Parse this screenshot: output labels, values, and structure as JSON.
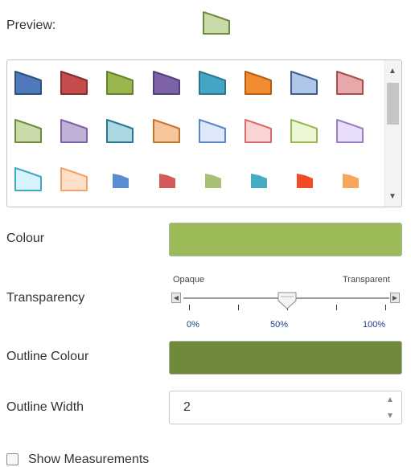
{
  "preview": {
    "label": "Preview:",
    "fill": "#cadbaa",
    "stroke": "#6f8a3a"
  },
  "gallery": {
    "symbols": [
      {
        "style": "outline",
        "fill": "#4f79b9",
        "stroke": "#2d4f80"
      },
      {
        "style": "outline",
        "fill": "#c44c4c",
        "stroke": "#8a2a2a"
      },
      {
        "style": "outline",
        "fill": "#98b84f",
        "stroke": "#65802f"
      },
      {
        "style": "outline",
        "fill": "#7e62a8",
        "stroke": "#54407a"
      },
      {
        "style": "outline",
        "fill": "#43a7c4",
        "stroke": "#2b7590"
      },
      {
        "style": "outline",
        "fill": "#f28a2f",
        "stroke": "#b55e12"
      },
      {
        "style": "outline",
        "fill": "#aec7e8",
        "stroke": "#3d5d8f"
      },
      {
        "style": "outline",
        "fill": "#e6a8a8",
        "stroke": "#a84d4d"
      },
      {
        "style": "outline",
        "fill": "#cadbaa",
        "stroke": "#6f8a3a"
      },
      {
        "style": "outline",
        "fill": "#c1b1d6",
        "stroke": "#7e62a8"
      },
      {
        "style": "outline",
        "fill": "#a9d8e3",
        "stroke": "#2b7590"
      },
      {
        "style": "outline",
        "fill": "#f7c59b",
        "stroke": "#c47532"
      },
      {
        "style": "outline",
        "fill": "#dde9fb",
        "stroke": "#5c83c6"
      },
      {
        "style": "outline",
        "fill": "#fbd3d3",
        "stroke": "#d86b6b"
      },
      {
        "style": "outline",
        "fill": "#edf7d6",
        "stroke": "#98b84f"
      },
      {
        "style": "outline",
        "fill": "#e8defa",
        "stroke": "#9a7fc4"
      },
      {
        "style": "outline",
        "fill": "#d6f3fb",
        "stroke": "#43a7c4"
      },
      {
        "style": "outline",
        "fill": "#fde0c7",
        "stroke": "#f2a36a"
      },
      {
        "style": "solid",
        "fill": "#5b8bd0"
      },
      {
        "style": "solid",
        "fill": "#d45a5a"
      },
      {
        "style": "solid",
        "fill": "#a8c073"
      },
      {
        "style": "solid",
        "fill": "#48abc4"
      },
      {
        "style": "solid",
        "fill": "#f24c27"
      },
      {
        "style": "solid",
        "fill": "#f7a65a"
      }
    ],
    "scroll_up": "▲",
    "scroll_down": "▼"
  },
  "colour": {
    "label": "Colour",
    "value": "#9bbb59"
  },
  "transparency": {
    "label": "Transparency",
    "min_label": "Opaque",
    "max_label": "Transparent",
    "value_percent": 50,
    "ticks": [
      "0%",
      "50%",
      "100%"
    ],
    "left_arrow": "◀",
    "right_arrow": "▶"
  },
  "outline_colour": {
    "label": "Outline Colour",
    "value": "#6f8a3a"
  },
  "outline_width": {
    "label": "Outline Width",
    "value": "2",
    "up": "▲",
    "down": "▼"
  },
  "show_measurements": {
    "label": "Show Measurements",
    "checked": false
  }
}
